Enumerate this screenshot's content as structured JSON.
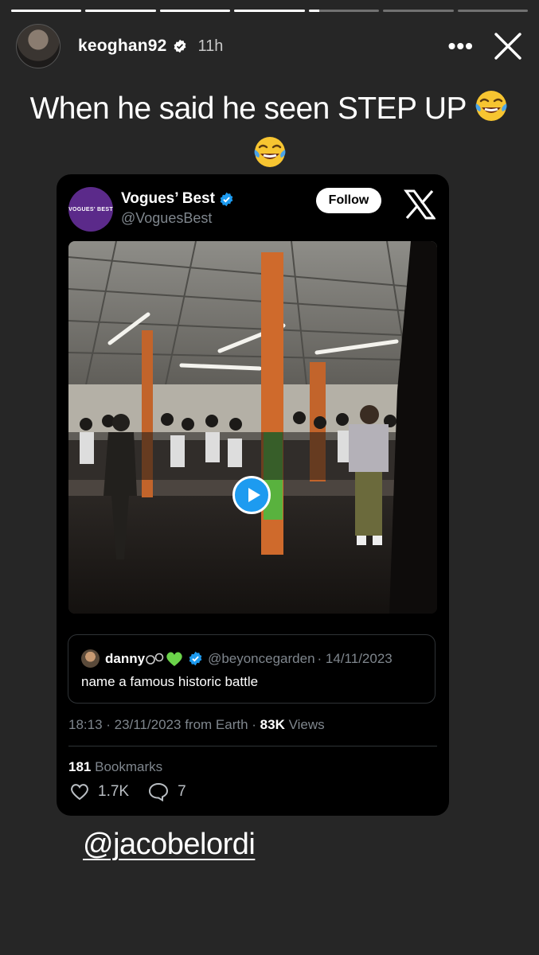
{
  "story": {
    "segments": 7,
    "active_index": 4,
    "active_progress": 0.15
  },
  "header": {
    "username": "keoghan92",
    "time": "11h",
    "more_icon": "more-horizontal-icon",
    "close_icon": "close-icon"
  },
  "caption": {
    "text_line1": "When he said he seen STEP UP",
    "emoji": "face-with-tears-of-joy"
  },
  "tweet": {
    "account_name": "Vogues’ Best",
    "account_handle": "@VoguesBest",
    "avatar_text": "VOGUES' BEST",
    "follow_label": "Follow",
    "quoted": {
      "name": "danny",
      "handle": "@beyoncegarden",
      "date": "· 14/11/2023",
      "text": "name a famous historic battle"
    },
    "time": "18:13 · 23/11/2023 from Earth ·",
    "views_count": "83K",
    "views_label": "Views",
    "bookmarks_count": "181",
    "bookmarks_label": "Bookmarks",
    "likes": "1.7K",
    "replies": "7"
  },
  "mention": "@jacobelordi",
  "colors": {
    "background": "#262626",
    "card": "#000000",
    "verified": "#1d9bf0",
    "secondary_text": "#7f868d"
  }
}
